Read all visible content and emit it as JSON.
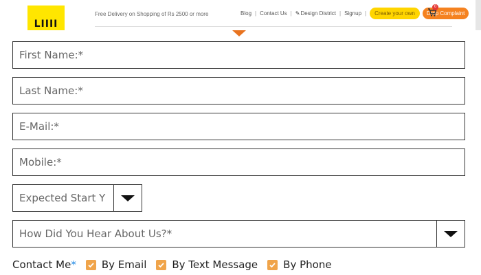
{
  "header": {
    "logo_text": "LIIII",
    "promo": "Free Delivery on Shopping of Rs 2500 or more",
    "nav": {
      "blog": "Blog",
      "contact": "Contact Us",
      "design_district": "Design District",
      "signup": "Signup"
    },
    "create_button": "Create your own",
    "complaint_button": "Drop Complaint",
    "cart_count": "0",
    "colors": {
      "logo": "#ffe600",
      "create": "#ffd500",
      "complaint": "#f58220",
      "caret": "#e8731f"
    }
  },
  "form": {
    "first_name": {
      "placeholder": "First Name:*"
    },
    "last_name": {
      "placeholder": "Last Name:*"
    },
    "email": {
      "placeholder": "E-Mail:*"
    },
    "mobile": {
      "placeholder": "Mobile:*"
    },
    "expected_start": {
      "selected": "Expected Start Y"
    },
    "hear_about": {
      "selected": "How Did You Hear About Us?*"
    },
    "contact": {
      "label": "Contact Me",
      "required": "*",
      "options": [
        {
          "label": "By Email",
          "checked": true
        },
        {
          "label": "By Text Message",
          "checked": true
        },
        {
          "label": "By Phone",
          "checked": true
        }
      ]
    }
  },
  "icons": [
    "pencil-icon",
    "cart-icon",
    "chevron-down-icon",
    "check-icon"
  ]
}
